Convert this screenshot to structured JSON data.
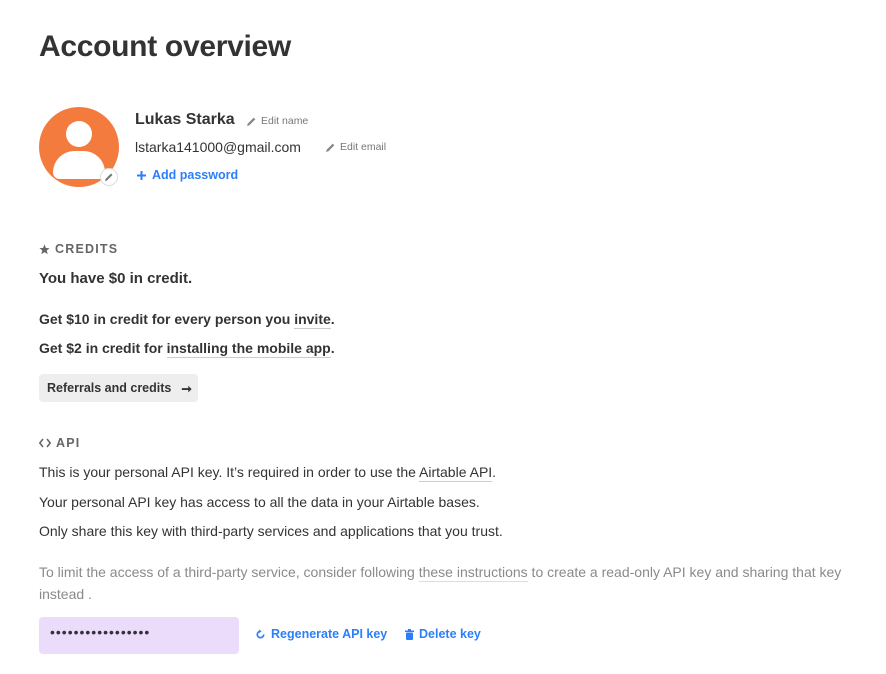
{
  "page": {
    "title": "Account overview"
  },
  "profile": {
    "name": "Lukas Starka",
    "edit_name_label": "Edit name",
    "email": "lstarka141000@gmail.com",
    "edit_email_label": "Edit email",
    "add_password_label": "Add password",
    "avatar_color": "#f47b3e"
  },
  "credits": {
    "section_label": "CREDITS",
    "balance_text": "You have $0 in credit.",
    "invite_prefix": "Get $10 in credit for every person you ",
    "invite_link": "invite",
    "invite_suffix": ".",
    "mobile_prefix": "Get $2 in credit for ",
    "mobile_link": "installing the mobile app",
    "mobile_suffix": ".",
    "referrals_button": "Referrals and credits",
    "referrals_arrow": "➞"
  },
  "api": {
    "section_label": "API",
    "line1_prefix": "This is your personal API key. It’s required in order to use the ",
    "line1_link": "Airtable API",
    "line1_suffix": ".",
    "line2": "Your personal API key has access to all the data in your Airtable bases.",
    "line3": "Only share this key with third-party services and applications that you trust.",
    "note_prefix": "To limit the access of a third-party service, consider following ",
    "note_link": "these instructions",
    "note_suffix": " to create a read-only API key and sharing that key instead .",
    "key_masked": "•••••••••••••••••",
    "regenerate_label": "Regenerate API key",
    "delete_label": "Delete key"
  },
  "colors": {
    "link": "#2d7ff9",
    "key_field_bg": "#ebdcfc"
  }
}
